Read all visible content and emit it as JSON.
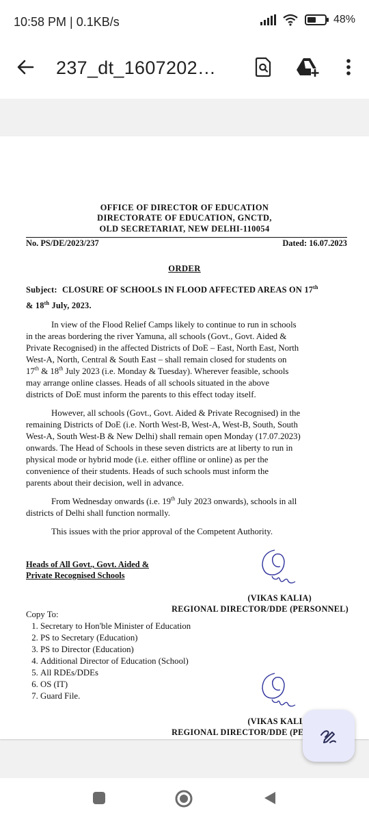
{
  "status_bar": {
    "time": "10:58 PM | 0.1KB/s",
    "battery": "48%",
    "battery_level": 0.48
  },
  "app_bar": {
    "title": "237_dt_1607202…",
    "icons": [
      "back-arrow-icon",
      "find-in-page-icon",
      "add-to-drive-icon",
      "more-vert-icon"
    ]
  },
  "document": {
    "header_lines": [
      "OFFICE OF DIRECTOR OF EDUCATION",
      "DIRECTORATE OF EDUCATION, GNCTD,",
      "OLD SECRETARIAT, NEW DELHI-110054"
    ],
    "ref_no": "No. PS/DE/2023/237",
    "dated": "Dated: 16.07.2023",
    "order_title": "ORDER",
    "subject": {
      "label": "Subject:",
      "text_a": "CLOSURE OF SCHOOLS IN FLOOD AFFECTED AREAS ON 17",
      "sup_a": "th",
      "text_b": "& 18",
      "sup_b": "th",
      "text_c": " July, 2023."
    },
    "para1": {
      "line1": "In view of the Flood Relief Camps likely to continue to run in schools",
      "line2": "in the areas bordering the river Yamuna, all schools (Govt., Govt. Aided &",
      "line3": "Private Recognised) in the affected Districts of DoE – East, North East, North",
      "line4": "West-A, North, Central & South East – shall remain closed for students on",
      "line5_a": "17",
      "line5_sup1": "th",
      "line5_b": " & 18",
      "line5_sup2": "th",
      "line5_c": " July 2023 (i.e. Monday & Tuesday). Wherever feasible, schools",
      "line6": "may arrange online classes. Heads of all schools situated in the above",
      "line7": "districts of DoE must inform the parents to this effect today itself."
    },
    "para2": [
      "However, all schools (Govt., Govt. Aided & Private Recognised) in the",
      "remaining Districts of DoE (i.e. North West-B, West-A, West-B, South, South",
      "West-A, South West-B & New Delhi) shall remain open Monday (17.07.2023)",
      "onwards. The Head of Schools in these seven districts are at liberty to run in",
      "physical mode or hybrid mode (i.e. either offline or online) as per the",
      "convenience of their students. Heads of such schools must inform the",
      "parents about their decision, well in advance."
    ],
    "para3": {
      "line1_a": "From Wednesday onwards (i.e. 19",
      "line1_sup": "th",
      "line1_b": " July 2023 onwards), schools in all",
      "line2": "districts of Delhi shall function normally."
    },
    "para4": "This issues with the prior approval of the Competent Authority.",
    "addressee": [
      "Heads of All Govt., Govt. Aided &",
      "Private Recognised Schools"
    ],
    "signatory_name": "(VIKAS KALIA)",
    "signatory_title": "REGIONAL DIRECTOR/DDE (PERSONNEL)",
    "copy_to_label": "Copy To:",
    "copy_to": [
      "Secretary to Hon'ble Minister of Education",
      "PS to Secretary (Education)",
      "PS to Director (Education)",
      "Additional Director of Education (School)",
      "All RDEs/DDEs",
      "OS (IT)",
      "Guard File."
    ]
  },
  "fab": {
    "icon": "edit-annotate-icon"
  },
  "nav_bar": {
    "icons": [
      "recents-square-icon",
      "home-circle-icon",
      "back-triangle-icon"
    ]
  }
}
